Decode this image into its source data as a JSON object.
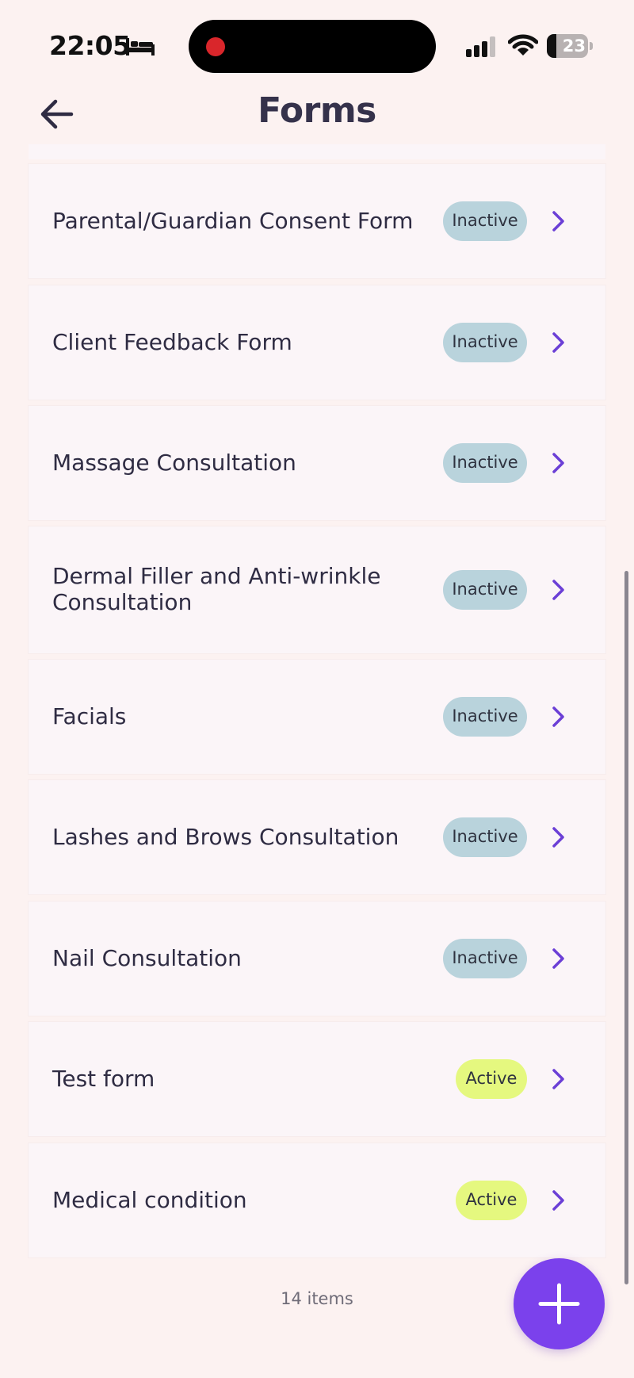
{
  "status_bar": {
    "time": "22:05",
    "battery_level": 23,
    "battery_text": "23",
    "icons": [
      "bed-icon",
      "signal-icon",
      "wifi-icon",
      "battery-icon"
    ]
  },
  "header": {
    "title": "Forms",
    "back_icon": "arrow-left-icon"
  },
  "forms": [
    {
      "name": "Parental/Guardian Consent Form",
      "status": "Inactive"
    },
    {
      "name": "Client Feedback Form",
      "status": "Inactive"
    },
    {
      "name": "Massage Consultation",
      "status": "Inactive"
    },
    {
      "name": "Dermal Filler and Anti-wrinkle Consultation",
      "status": "Inactive"
    },
    {
      "name": "Facials",
      "status": "Inactive"
    },
    {
      "name": "Lashes and Brows Consultation",
      "status": "Inactive"
    },
    {
      "name": "Nail Consultation",
      "status": "Inactive"
    },
    {
      "name": "Test form",
      "status": "Active"
    },
    {
      "name": "Medical condition",
      "status": "Active"
    }
  ],
  "footer": {
    "count_text": "14 items"
  },
  "fab": {
    "icon": "plus-icon"
  },
  "colors": {
    "background": "#fcf2f1",
    "row": "#fbf5f8",
    "accent": "#7b41ec",
    "inactive_badge": "#b9d3dc",
    "active_badge": "#e5f87f"
  }
}
